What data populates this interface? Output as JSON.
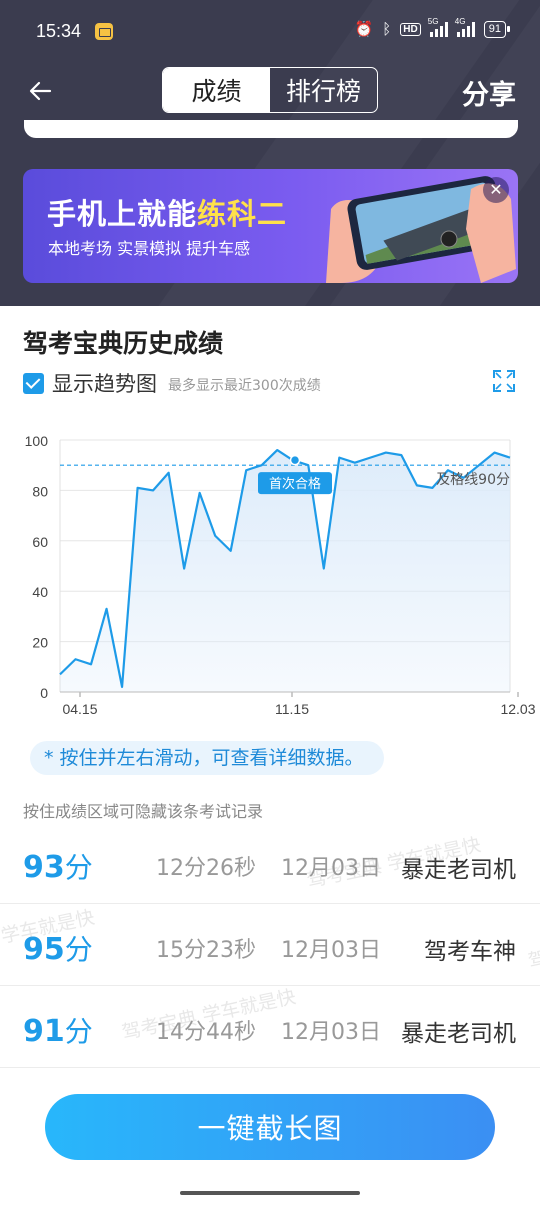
{
  "status_bar": {
    "time": "15:34",
    "network_1": "5G",
    "network_2": "4G",
    "hd_label": "HD",
    "battery": "91"
  },
  "nav": {
    "tab_scores": "成绩",
    "tab_ranking": "排行榜",
    "share_label": "分享"
  },
  "banner": {
    "title_prefix": "手机上就能",
    "title_highlight": "练科二",
    "subtitle": "本地考场 实景模拟 提升车感",
    "close_glyph": "✕"
  },
  "history": {
    "title": "驾考宝典历史成绩",
    "show_trend_label": "显示趋势图",
    "trend_note": "最多显示最近300次成绩",
    "hint": "* 按住并左右滑动，可查看详细数据。",
    "hide_tip": "按住成绩区域可隐藏该条考试记录"
  },
  "chart_data": {
    "type": "area",
    "x_tick_labels": [
      "04.15",
      "11.15",
      "12.03"
    ],
    "y_ticks": [
      0,
      20,
      40,
      60,
      80,
      100
    ],
    "ylim": [
      0,
      100
    ],
    "values": [
      7,
      13,
      11,
      33,
      2,
      81,
      80,
      87,
      49,
      79,
      62,
      56,
      88,
      90,
      96,
      92,
      90,
      49,
      93,
      91,
      93,
      95,
      94,
      82,
      81,
      88,
      85,
      90,
      95,
      93
    ],
    "pass_line": 90,
    "pass_line_label": "及格线90分",
    "first_pass_label": "首次合格",
    "first_pass_value": 92,
    "line_color": "#1e9be8",
    "fill_color": "#dcebfa",
    "grid": true
  },
  "records": [
    {
      "score": "93",
      "unit": "分",
      "duration": "12分26秒",
      "date": "12月03日",
      "title": "暴走老司机"
    },
    {
      "score": "95",
      "unit": "分",
      "duration": "15分23秒",
      "date": "12月03日",
      "title": "驾考车神"
    },
    {
      "score": "91",
      "unit": "分",
      "duration": "14分44秒",
      "date": "12月03日",
      "title": "暴走老司机"
    }
  ],
  "watermarks": [
    "驾考宝典 学车就是快",
    "学车就是快",
    "驾考宝典 学车就是快",
    "驾"
  ],
  "cta_label": "一键截长图",
  "colors": {
    "accent": "#1e9be8",
    "header_bg": "#3b3c4f",
    "banner_highlight": "#ffe14a"
  }
}
